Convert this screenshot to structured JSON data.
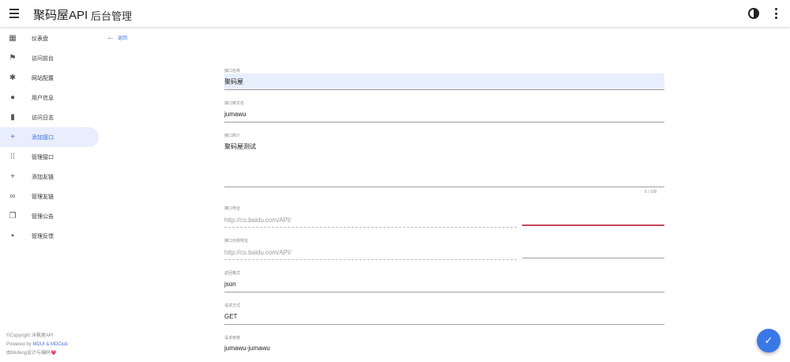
{
  "appbar": {
    "brand": "聚码屋API",
    "subtitle": "后台管理",
    "menu_icon": "menu-icon",
    "theme_icon": "brightness-icon",
    "more_icon": "more-vert-icon"
  },
  "sidebar": {
    "items": [
      {
        "label": "仪表盘",
        "icon": "dashboard-icon",
        "glyph": "▦"
      },
      {
        "label": "访问前台",
        "icon": "flag-icon",
        "glyph": "⚑"
      },
      {
        "label": "网站配置",
        "icon": "gear-icon",
        "glyph": "✱"
      },
      {
        "label": "用户信息",
        "icon": "person-icon",
        "glyph": "●"
      },
      {
        "label": "访问日志",
        "icon": "file-icon",
        "glyph": "▮"
      },
      {
        "label": "添加接口",
        "icon": "plus-icon",
        "glyph": "+"
      },
      {
        "label": "管理接口",
        "icon": "apps-icon",
        "glyph": "⁞⁞"
      },
      {
        "label": "添加友链",
        "icon": "plus-icon",
        "glyph": "+"
      },
      {
        "label": "管理友链",
        "icon": "link-icon",
        "glyph": "∞"
      },
      {
        "label": "管理公告",
        "icon": "library-icon",
        "glyph": "❐"
      },
      {
        "label": "管理反馈",
        "icon": "feedback-icon",
        "glyph": "▪"
      }
    ],
    "active_index": 5,
    "footer": {
      "line1": "©Copyright 沐枫屋API",
      "line2_prefix": "Powered by ",
      "line2_link": "MDUI & MDClub",
      "line3": "由Mufeng设计与编码💗"
    }
  },
  "back": {
    "label": "返回",
    "icon": "arrow-back-icon"
  },
  "form": {
    "name": {
      "label": "接口名称",
      "value": "聚码屋"
    },
    "en_name": {
      "label": "接口英文名",
      "value": "jumawu"
    },
    "intro": {
      "label": "接口简介",
      "value": "聚码屋测试",
      "counter": "5 / 100"
    },
    "url": {
      "label": "接口地址",
      "placeholder": "http://cs.baidu.com/API/"
    },
    "example_url": {
      "label": "接口示例地址",
      "placeholder": "http://cs.baidu.com/API/"
    },
    "format": {
      "label": "返回格式",
      "value": "json"
    },
    "method": {
      "label": "请求方式",
      "value": "GET"
    },
    "params": {
      "label": "请求参数",
      "value": "jumawu-jumawu"
    }
  },
  "fab": {
    "icon": "check-icon"
  }
}
